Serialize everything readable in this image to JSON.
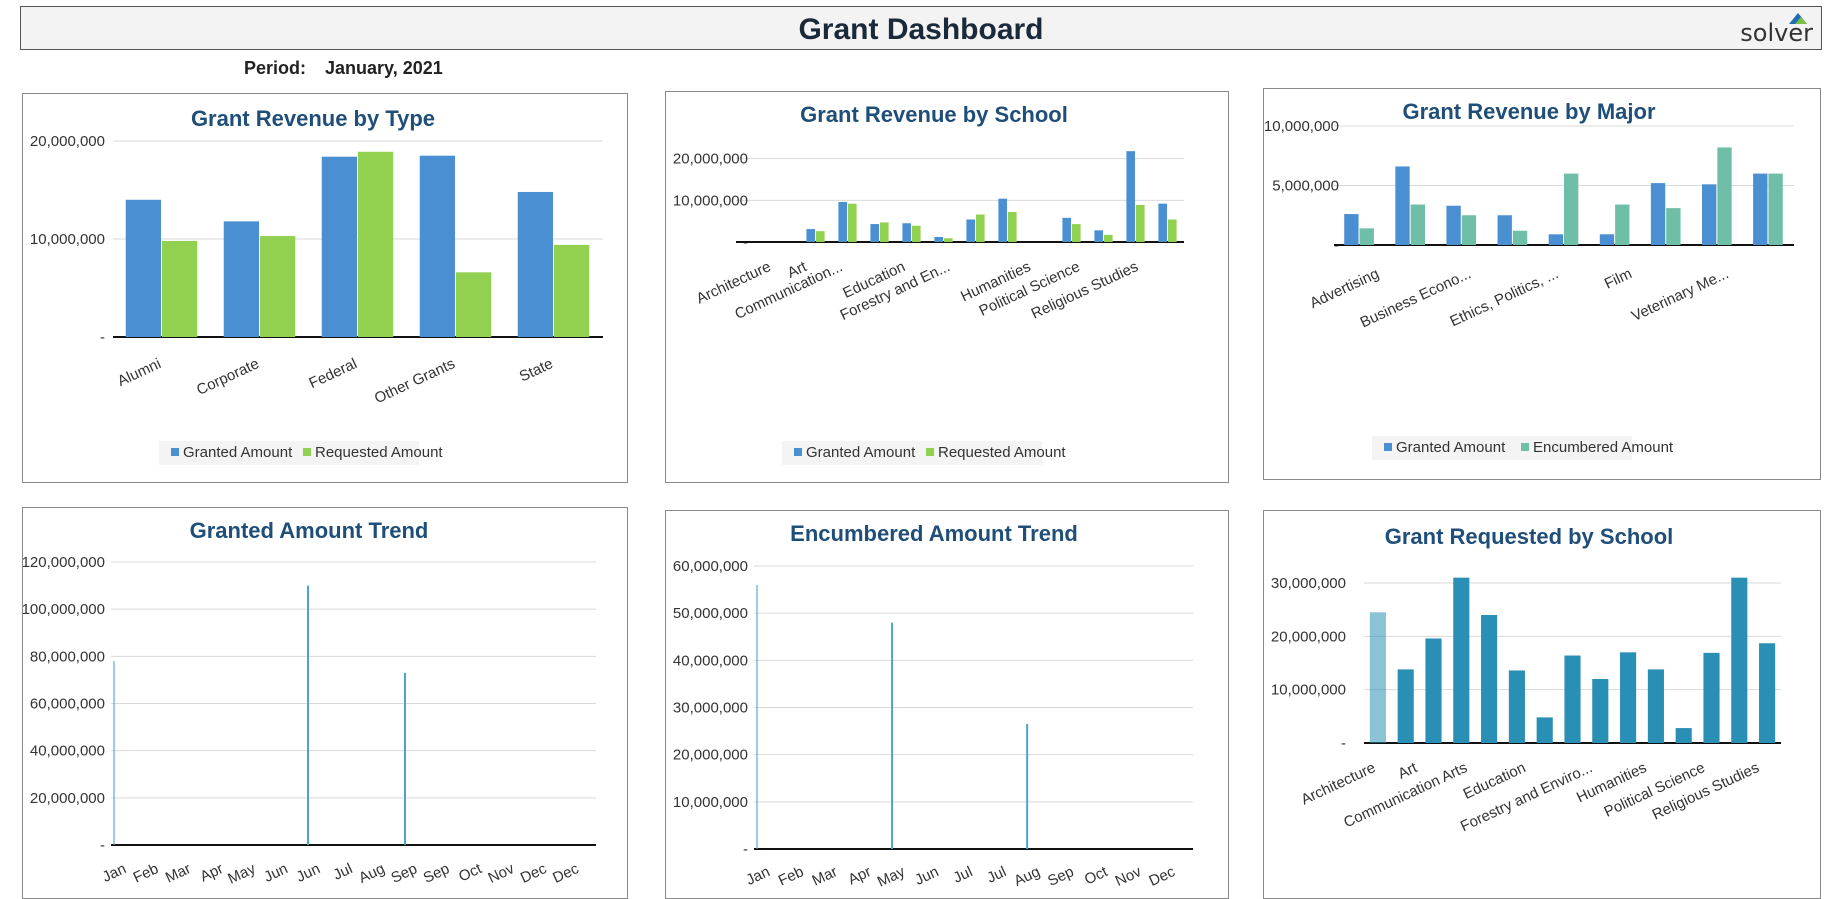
{
  "header": {
    "title": "Grant Dashboard",
    "logo": "solver"
  },
  "period": {
    "label": "Period:",
    "value": "January, 2021"
  },
  "colors": {
    "granted": "#4a8fd1",
    "requested": "#92d050",
    "encumbered": "#6fbfa8",
    "trend": "#4aa6c9",
    "school": "#2a8fb4"
  },
  "chart_data": [
    {
      "type": "bar",
      "title": "Grant Revenue by Type",
      "categories": [
        "Alumni",
        "Corporate",
        "Federal",
        "Other Grants",
        "State"
      ],
      "series": [
        {
          "name": "Granted Amount",
          "values": [
            14000000,
            11800000,
            18400000,
            18500000,
            14800000
          ]
        },
        {
          "name": "Requested Amount",
          "values": [
            9800000,
            10300000,
            18900000,
            6600000,
            9400000
          ]
        }
      ],
      "ylim": [
        0,
        20000000
      ],
      "yticks": [
        "20,000,000",
        "10,000,000",
        "-"
      ],
      "legend": "bottom"
    },
    {
      "type": "bar",
      "title": "Grant Revenue by School",
      "categories": [
        "Architecture",
        "Art",
        "Communication...",
        "Education",
        "Forestry and En...",
        "Humanities",
        "Political Science",
        "Religious Studies"
      ],
      "series": [
        {
          "name": "Granted Amount",
          "values": [
            0,
            0,
            3100000,
            9600000,
            4300000,
            4500000,
            1200000,
            5400000,
            10400000,
            0,
            5800000,
            2800000,
            21800000,
            9200000
          ]
        },
        {
          "name": "Requested Amount",
          "values": [
            0,
            0,
            2600000,
            9200000,
            4700000,
            3900000,
            900000,
            6600000,
            7200000,
            0,
            4300000,
            1700000,
            8900000,
            5400000
          ]
        }
      ],
      "ylim": [
        0,
        24000000
      ],
      "yticks": [
        "20,000,000",
        "10,000,000",
        "-"
      ],
      "legend": "bottom"
    },
    {
      "type": "bar",
      "title": "Grant Revenue by Major",
      "categories": [
        "Advertising",
        "Business Econo...",
        "Ethics, Politics, ...",
        "Film",
        "Veterinary Me..."
      ],
      "series": [
        {
          "name": "Granted Amount",
          "values": [
            2600000,
            6600000,
            3300000,
            2500000,
            900000,
            900000,
            5200000,
            5100000,
            6000000
          ]
        },
        {
          "name": "Encumbered Amount",
          "values": [
            1400000,
            3400000,
            2500000,
            1200000,
            6000000,
            3400000,
            3100000,
            8200000,
            6000000
          ]
        }
      ],
      "ylim": [
        0,
        10000000
      ],
      "yticks": [
        "10,000,000",
        "5,000,000",
        "-"
      ],
      "legend": "bottom"
    },
    {
      "type": "bar",
      "title": "Granted Amount Trend",
      "categories": [
        "Jan",
        "Feb",
        "Mar",
        "Apr",
        "May",
        "Jun",
        "Jun",
        "Jul",
        "Aug",
        "Sep",
        "Sep",
        "Oct",
        "Nov",
        "Dec",
        "Dec"
      ],
      "values": [
        78000000,
        0,
        0,
        0,
        0,
        0,
        110000000,
        0,
        0,
        73000000,
        0,
        0,
        0,
        0,
        0
      ],
      "ylim": [
        0,
        120000000
      ],
      "yticks": [
        "120,000,000",
        "100,000,000",
        "80,000,000",
        "60,000,000",
        "40,000,000",
        "20,000,000",
        "-"
      ]
    },
    {
      "type": "bar",
      "title": "Encumbered Amount Trend",
      "categories": [
        "Jan",
        "Feb",
        "Mar",
        "Apr",
        "May",
        "Jun",
        "Jul",
        "Jul",
        "Aug",
        "Sep",
        "Oct",
        "Nov",
        "Dec"
      ],
      "values": [
        56000000,
        0,
        0,
        0,
        48000000,
        0,
        0,
        0,
        26500000,
        0,
        0,
        0,
        0
      ],
      "ylim": [
        0,
        60000000
      ],
      "yticks": [
        "60,000,000",
        "50,000,000",
        "40,000,000",
        "30,000,000",
        "20,000,000",
        "10,000,000",
        "-"
      ]
    },
    {
      "type": "bar",
      "title": "Grant Requested by School",
      "categories": [
        "Architecture",
        "Art",
        "Communication Arts",
        "Education",
        "Forestry and Enviro...",
        "Humanities",
        "Political Science",
        "Religious Studies"
      ],
      "values": [
        24500000,
        13800000,
        19600000,
        31000000,
        24000000,
        13600000,
        4800000,
        16400000,
        12000000,
        17000000,
        13800000,
        2800000,
        16900000,
        31000000,
        18700000
      ],
      "ylim": [
        0,
        30000000
      ],
      "yticks": [
        "30,000,000",
        "20,000,000",
        "10,000,000",
        "-"
      ]
    }
  ]
}
